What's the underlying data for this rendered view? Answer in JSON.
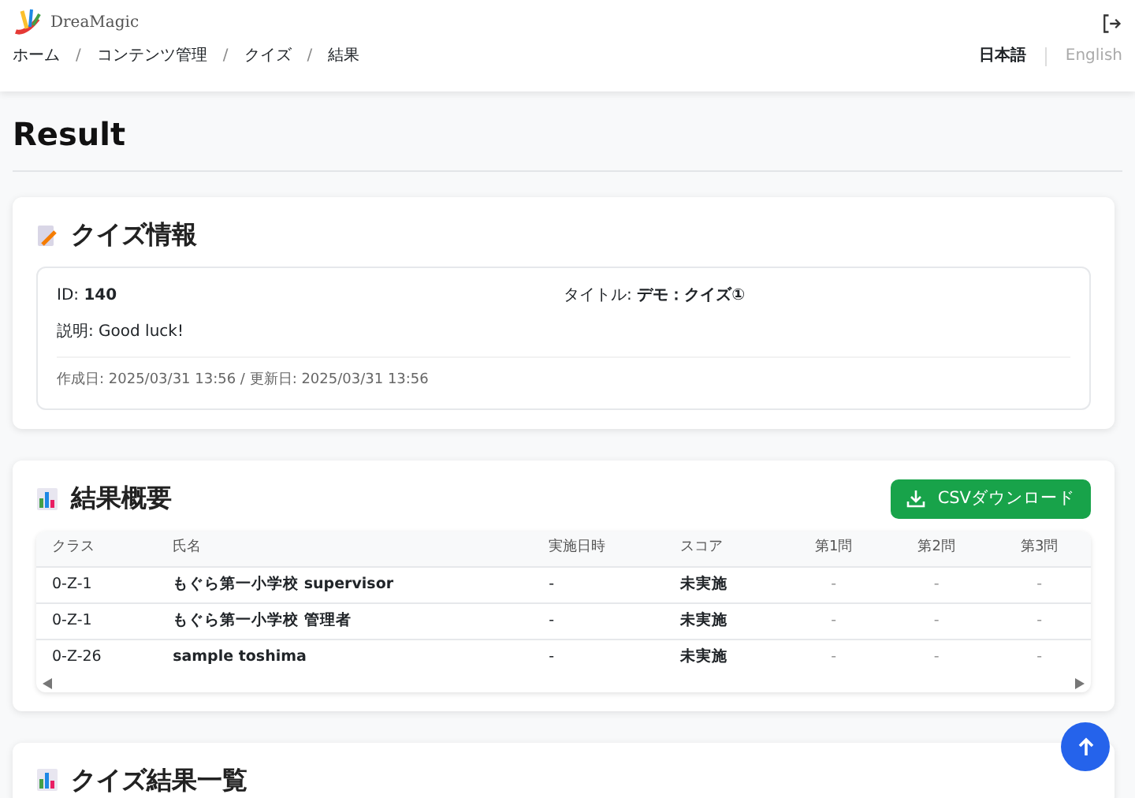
{
  "header": {
    "logo_text": "DreaMagic",
    "breadcrumb": [
      {
        "label": "ホーム",
        "separator": "/"
      },
      {
        "label": "コンテンツ管理",
        "separator": "/"
      },
      {
        "label": "クイズ",
        "separator": "/"
      },
      {
        "label": "結果"
      }
    ],
    "languages": [
      {
        "label": "日本語",
        "selected": true
      },
      {
        "label": "English",
        "selected": false
      }
    ]
  },
  "page_title": "Result",
  "quiz_info": {
    "title": "クイズ情報",
    "id_label": "ID:",
    "id_value": "140",
    "title_label": "タイトル:",
    "title_value": "デモ：クイズ①",
    "description_label": "説明:",
    "description_value": "Good luck!",
    "dates": "作成日: 2025/03/31 13:56 / 更新日: 2025/03/31 13:56"
  },
  "summary": {
    "title": "結果概要",
    "button": "CSVダウンロード",
    "table": {
      "columns": [
        "クラス",
        "氏名",
        "実施日時",
        "スコア",
        "第1問",
        "第2問",
        "第3問"
      ],
      "rows": [
        [
          "0-Z-1",
          "もぐら第一小学校 supervisor",
          "-",
          "未実施",
          "-",
          "-",
          "-"
        ],
        [
          "0-Z-1",
          "もぐら第一小学校 管理者",
          "-",
          "未実施",
          "-",
          "-",
          "-"
        ],
        [
          "0-Z-26",
          "sample toshima",
          "-",
          "未実施",
          "-",
          "-",
          "-"
        ]
      ]
    }
  },
  "results_list": {
    "title": "クイズ結果一覧"
  }
}
